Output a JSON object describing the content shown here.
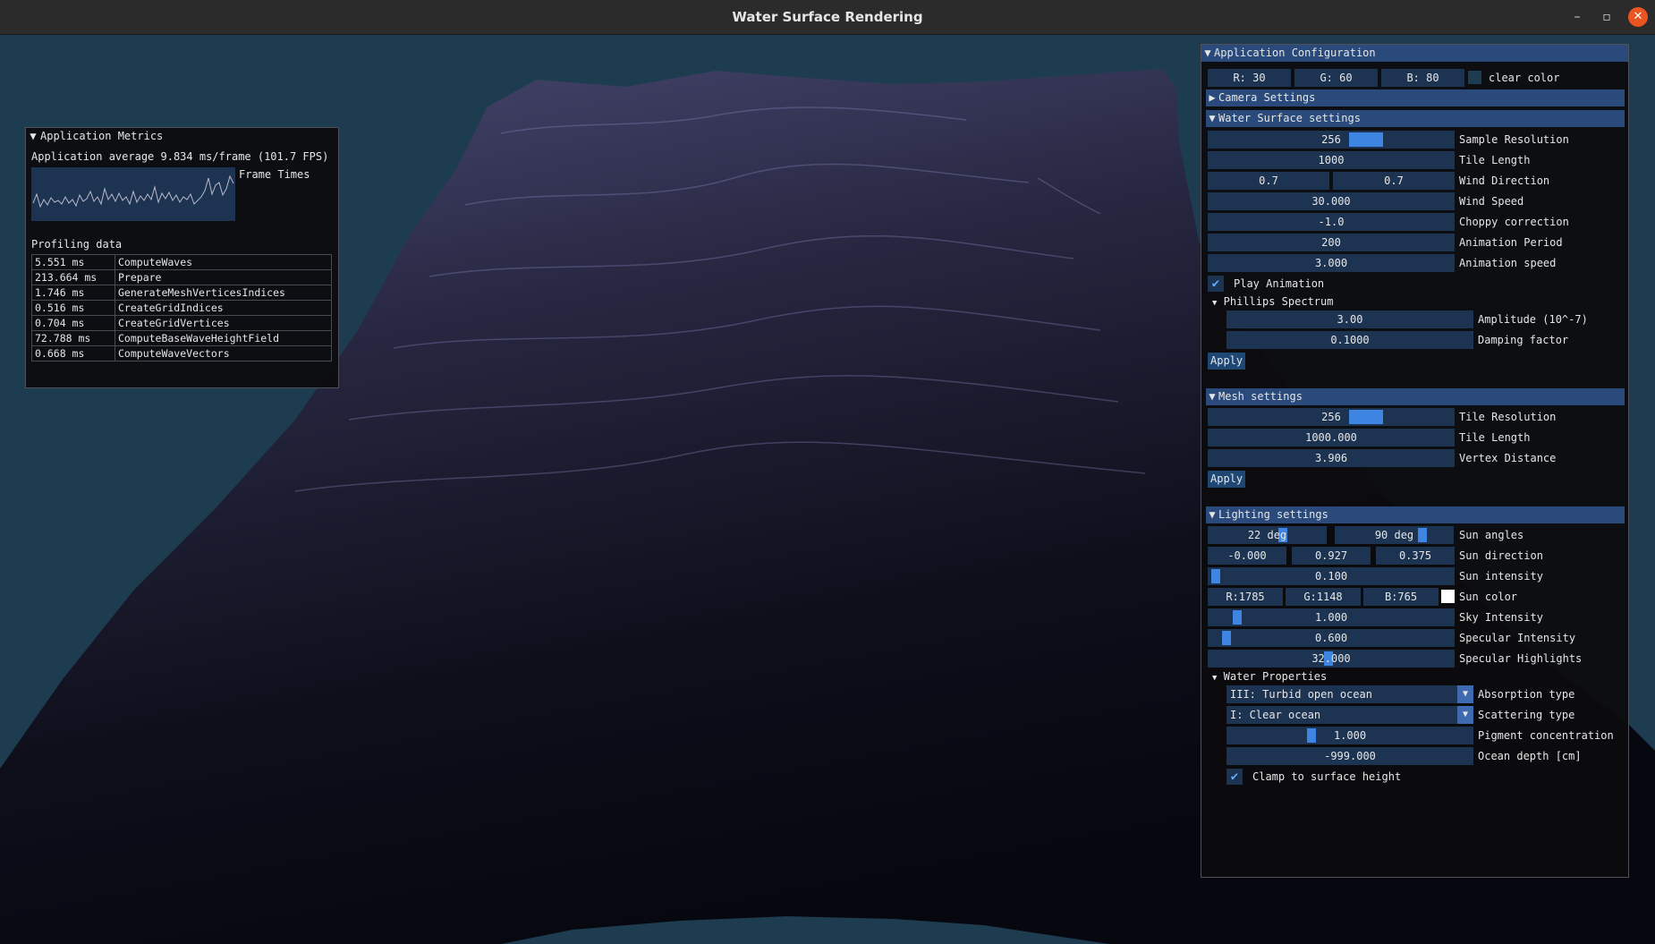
{
  "window": {
    "title": "Water Surface Rendering",
    "controls": {
      "minimize": "–",
      "maximize": "▫",
      "close": "✕"
    }
  },
  "metrics": {
    "title": "Application Metrics",
    "average": "Application average 9.834 ms/frame (101.7 FPS)",
    "frame_times_label": "Frame Times",
    "profiling_label": "Profiling data",
    "rows": [
      {
        "time": "5.551 ms",
        "name": "ComputeWaves"
      },
      {
        "time": "213.664 ms",
        "name": "Prepare"
      },
      {
        "time": "1.746 ms",
        "name": "GenerateMeshVerticesIndices"
      },
      {
        "time": "0.516 ms",
        "name": "CreateGridIndices"
      },
      {
        "time": "0.704 ms",
        "name": "CreateGridVertices"
      },
      {
        "time": "72.788 ms",
        "name": "ComputeBaseWaveHeightField"
      },
      {
        "time": "0.668 ms",
        "name": "ComputeWaveVectors"
      }
    ]
  },
  "config": {
    "title": "Application Configuration",
    "clear_color": {
      "r": "R: 30",
      "g": "G: 60",
      "b": "B: 80",
      "label": "clear color"
    },
    "camera": {
      "title": "Camera Settings"
    },
    "water": {
      "title": "Water Surface settings",
      "sample_resolution": {
        "value": "256",
        "label": "Sample Resolution"
      },
      "tile_length": {
        "value": "1000",
        "label": "Tile Length"
      },
      "wind_direction": {
        "x": "0.7",
        "y": "0.7",
        "label": "Wind Direction"
      },
      "wind_speed": {
        "value": "30.000",
        "label": "Wind Speed"
      },
      "choppy": {
        "value": "-1.0",
        "label": "Choppy correction"
      },
      "anim_period": {
        "value": "200",
        "label": "Animation Period"
      },
      "anim_speed": {
        "value": "3.000",
        "label": "Animation speed"
      },
      "play": {
        "label": "Play Animation"
      },
      "phillips": {
        "title": "Phillips Spectrum",
        "amplitude": {
          "value": "3.00",
          "label": "Amplitude (10^-7)"
        },
        "damping": {
          "value": "0.1000",
          "label": "Damping factor"
        }
      },
      "apply": "Apply"
    },
    "mesh": {
      "title": "Mesh settings",
      "tile_resolution": {
        "value": "256",
        "label": "Tile Resolution"
      },
      "tile_length": {
        "value": "1000.000",
        "label": "Tile Length"
      },
      "vertex_distance": {
        "value": "3.906",
        "label": "Vertex Distance"
      },
      "apply": "Apply"
    },
    "lighting": {
      "title": "Lighting settings",
      "sun_angles": {
        "a": "22 deg",
        "b": "90 deg",
        "label": "Sun angles"
      },
      "sun_direction": {
        "x": "-0.000",
        "y": "0.927",
        "z": "0.375",
        "label": "Sun direction"
      },
      "sun_intensity": {
        "value": "0.100",
        "label": "Sun intensity"
      },
      "sun_color": {
        "r": "R:1785",
        "g": "G:1148",
        "b": "B:765",
        "label": "Sun color"
      },
      "sky_intensity": {
        "value": "1.000",
        "label": "Sky Intensity"
      },
      "specular_intensity": {
        "value": "0.600",
        "label": "Specular Intensity"
      },
      "specular_highlights": {
        "value": "32.000",
        "label": "Specular Highlights"
      }
    },
    "water_props": {
      "title": "Water Properties",
      "absorption": {
        "value": "III: Turbid open ocean",
        "label": "Absorption type"
      },
      "scattering": {
        "value": "I: Clear ocean",
        "label": "Scattering type"
      },
      "pigment": {
        "value": "1.000",
        "label": "Pigment concentration"
      },
      "depth": {
        "value": "-999.000",
        "label": "Ocean depth [cm]"
      },
      "clamp": {
        "label": "Clamp to surface height"
      }
    }
  },
  "colors": {
    "clear": "#1e3c50",
    "accent": "#3d85e0",
    "header": "#294a7a",
    "frame": "#1d3352"
  }
}
